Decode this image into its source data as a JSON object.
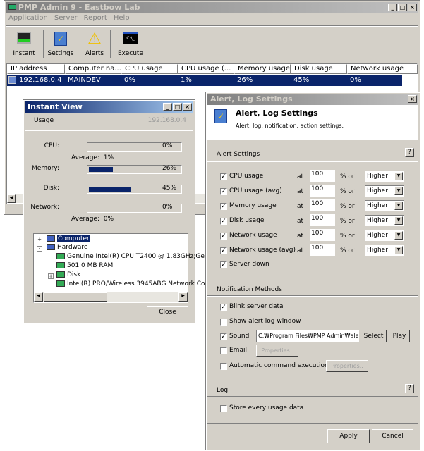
{
  "main": {
    "title": "PMP Admin 9 - Eastbow Lab",
    "menu": [
      "Application",
      "Server",
      "Report",
      "Help"
    ],
    "toolbar": [
      "Instant",
      "Settings",
      "Alerts",
      "Execute"
    ],
    "columns": [
      "IP address",
      "Computer na...",
      "CPU usage",
      "CPU usage (...",
      "Memory usage",
      "Disk usage",
      "Network usage"
    ],
    "row": [
      "192.168.0.4",
      "MAINDEV",
      "0%",
      "1%",
      "26%",
      "45%",
      "0%"
    ]
  },
  "instant": {
    "title": "Instant View",
    "usage": "Usage",
    "ip": "192.168.0.4",
    "metrics": [
      {
        "label": "CPU:",
        "value": "0%",
        "fill": 0,
        "avg": "Average:  1%"
      },
      {
        "label": "Memory:",
        "value": "26%",
        "fill": 26
      },
      {
        "label": "Disk:",
        "value": "45%",
        "fill": 45
      },
      {
        "label": "Network:",
        "value": "0%",
        "fill": 0,
        "avg": "Average:  0%"
      }
    ],
    "tree": [
      "Computer",
      "Hardware",
      "Genuine Intel(R) CPU T2400 @ 1.83GHz;Ger",
      "501.0 MB RAM",
      "Disk",
      "Intel(R) PRO/Wireless 3945ABG Network Co"
    ],
    "close": "Close"
  },
  "alert": {
    "title": "Alert, Log Settings",
    "heading": "Alert, Log Settings",
    "subheading": "Alert, log, notification, action settings.",
    "alert_section": "Alert Settings",
    "help": "?",
    "at": "at",
    "pct": "% or",
    "rules": [
      {
        "label": "CPU usage",
        "value": "100",
        "mode": "Higher"
      },
      {
        "label": "CPU usage (avg)",
        "value": "100",
        "mode": "Higher"
      },
      {
        "label": "Memory usage",
        "value": "100",
        "mode": "Higher"
      },
      {
        "label": "Disk usage",
        "value": "100",
        "mode": "Higher"
      },
      {
        "label": "Network usage",
        "value": "100",
        "mode": "Higher"
      },
      {
        "label": "Network usage (avg)",
        "value": "100",
        "mode": "Higher"
      }
    ],
    "server_down": "Server down",
    "notif_section": "Notification Methods",
    "blink": "Blink server data",
    "show_log": "Show alert log window",
    "sound": "Sound",
    "sound_path": "C:₩Program Files₩PMP Admin₩ale",
    "select": "Select",
    "play": "Play",
    "email": "Email",
    "properties": "Properties..",
    "auto": "Automatic command execution",
    "log_section": "Log",
    "store": "Store every usage data",
    "apply": "Apply",
    "cancel": "Cancel"
  }
}
